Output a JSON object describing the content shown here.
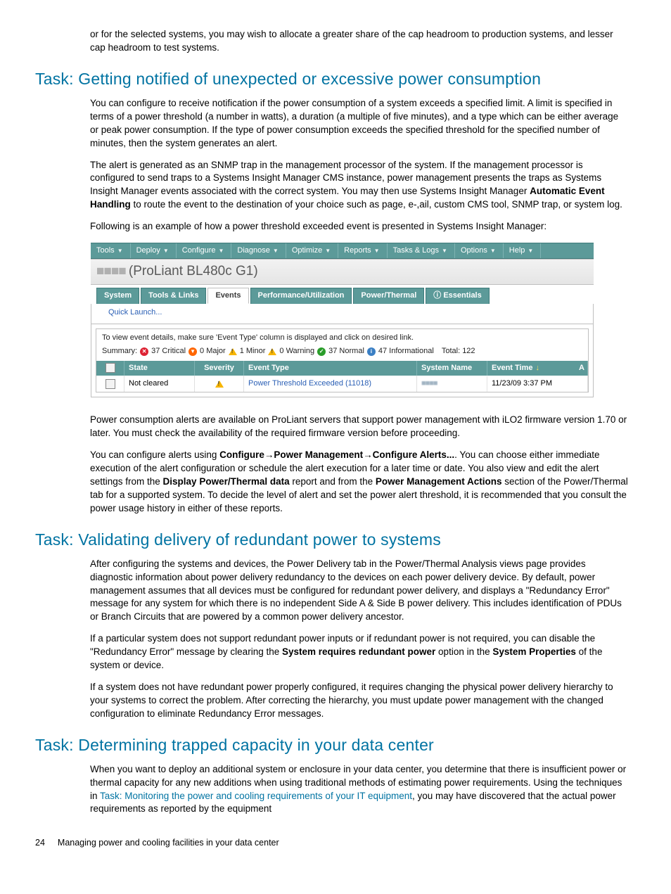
{
  "intro_paragraph": "or for the selected systems, you may wish to allocate a greater share of the cap headroom to production systems, and lesser cap headroom to test systems.",
  "task1": {
    "heading": "Task: Getting notified of unexpected or excessive power consumption",
    "p1": "You can configure to receive notification if the power consumption of a system exceeds a specified limit. A limit is specified in terms of a power threshold (a number in watts), a duration (a multiple of five minutes), and a type which can be either average or peak power consumption. If the type of power consumption exceeds the specified threshold for the specified number of minutes, then the system generates an alert.",
    "p2a": "The alert is generated as an SNMP trap in the management processor of the system. If the management processor is configured to send traps to a Systems Insight Manager CMS instance, power management presents the traps as Systems Insight Manager events associated with the correct system. You may then use Systems Insight Manager ",
    "p2b": "Automatic Event Handling",
    "p2c": " to route the event to the destination of your choice such as page, e-,ail, custom CMS tool, SNMP trap, or system log.",
    "p3": "Following is an example of how a power threshold exceeded event is presented in Systems Insight Manager:"
  },
  "screenshot": {
    "menu": [
      "Tools",
      "Deploy",
      "Configure",
      "Diagnose",
      "Optimize",
      "Reports",
      "Tasks & Logs",
      "Options",
      "Help"
    ],
    "device_prefix": "■■■■",
    "device": "(ProLiant BL480c G1)",
    "tabs": [
      "System",
      "Tools & Links",
      "Events",
      "Performance/Utilization",
      "Power/Thermal",
      "Essentials"
    ],
    "active_tab": "Events",
    "quick": "Quick Launch...",
    "helptext": "To view event details, make sure 'Event Type' column is displayed and click on desired link.",
    "summary_label": "Summary:",
    "summary": {
      "critical": "37 Critical",
      "major": "0 Major",
      "minor": "1 Minor",
      "warning": "0 Warning",
      "normal": "37 Normal",
      "informational": "47 Informational",
      "total": "Total: 122"
    },
    "columns": [
      "State",
      "Severity",
      "Event Type",
      "System Name",
      "Event Time"
    ],
    "row": {
      "state": "Not cleared",
      "event_type": "Power Threshold Exceeded (11018)",
      "system_name": "■■■■",
      "event_time": "11/23/09 3:37 PM"
    }
  },
  "after1": {
    "p1": "Power consumption alerts are available on ProLiant servers that support power management with iLO2 firmware version 1.70 or later. You must check the availability of the required firmware version before proceeding.",
    "p2a": "You can configure alerts using ",
    "p2_path": "Configure→Power Management→Configure Alerts...",
    "p2b": ". You can choose either immediate execution of the alert configuration or schedule the alert execution for a later time or date. You also view and edit the alert settings from the ",
    "p2_bold2": "Display Power/Thermal data",
    "p2c": " report and from the ",
    "p2_bold3": "Power Management Actions",
    "p2d": " section of the Power/Thermal tab for a supported system. To decide the level of alert and set the power alert threshold, it is recommended that you consult the power usage history in either of these reports."
  },
  "task2": {
    "heading": "Task: Validating delivery of redundant power to systems",
    "p1": "After configuring the systems and devices, the Power Delivery tab in the Power/Thermal Analysis views page provides diagnostic information about power delivery redundancy to the devices on each power delivery device. By default, power management assumes that all devices must be configured for redundant power delivery, and displays a \"Redundancy Error\" message for any system for which there is no independent Side A & Side B power delivery. This includes identification of PDUs or Branch Circuits that are powered by a common power delivery ancestor.",
    "p2a": "If a particular system does not support redundant power inputs or if redundant power is not required, you can disable the \"Redundancy Error\" message by clearing the ",
    "p2_bold1": "System requires redundant power",
    "p2b": " option in the ",
    "p2_bold2": "System Properties",
    "p2c": " of the system or device.",
    "p3": "If a system does not have redundant power properly configured, it requires changing the physical power delivery hierarchy to your systems to correct the problem. After correcting the hierarchy, you must update power management with the changed configuration to eliminate Redundancy Error messages."
  },
  "task3": {
    "heading": "Task: Determining trapped capacity in your data center",
    "p1a": "When you want to deploy an additional system or enclosure in your data center, you determine that there is insufficient power or thermal capacity for any new additions when using traditional methods of estimating power requirements. Using the techniques in ",
    "p1_link": "Task: Monitoring the power and cooling requirements of your IT equipment",
    "p1b": ", you may have discovered that the actual power requirements as reported by the equipment"
  },
  "footer": {
    "page": "24",
    "title": "Managing power and cooling facilities in your data center"
  }
}
